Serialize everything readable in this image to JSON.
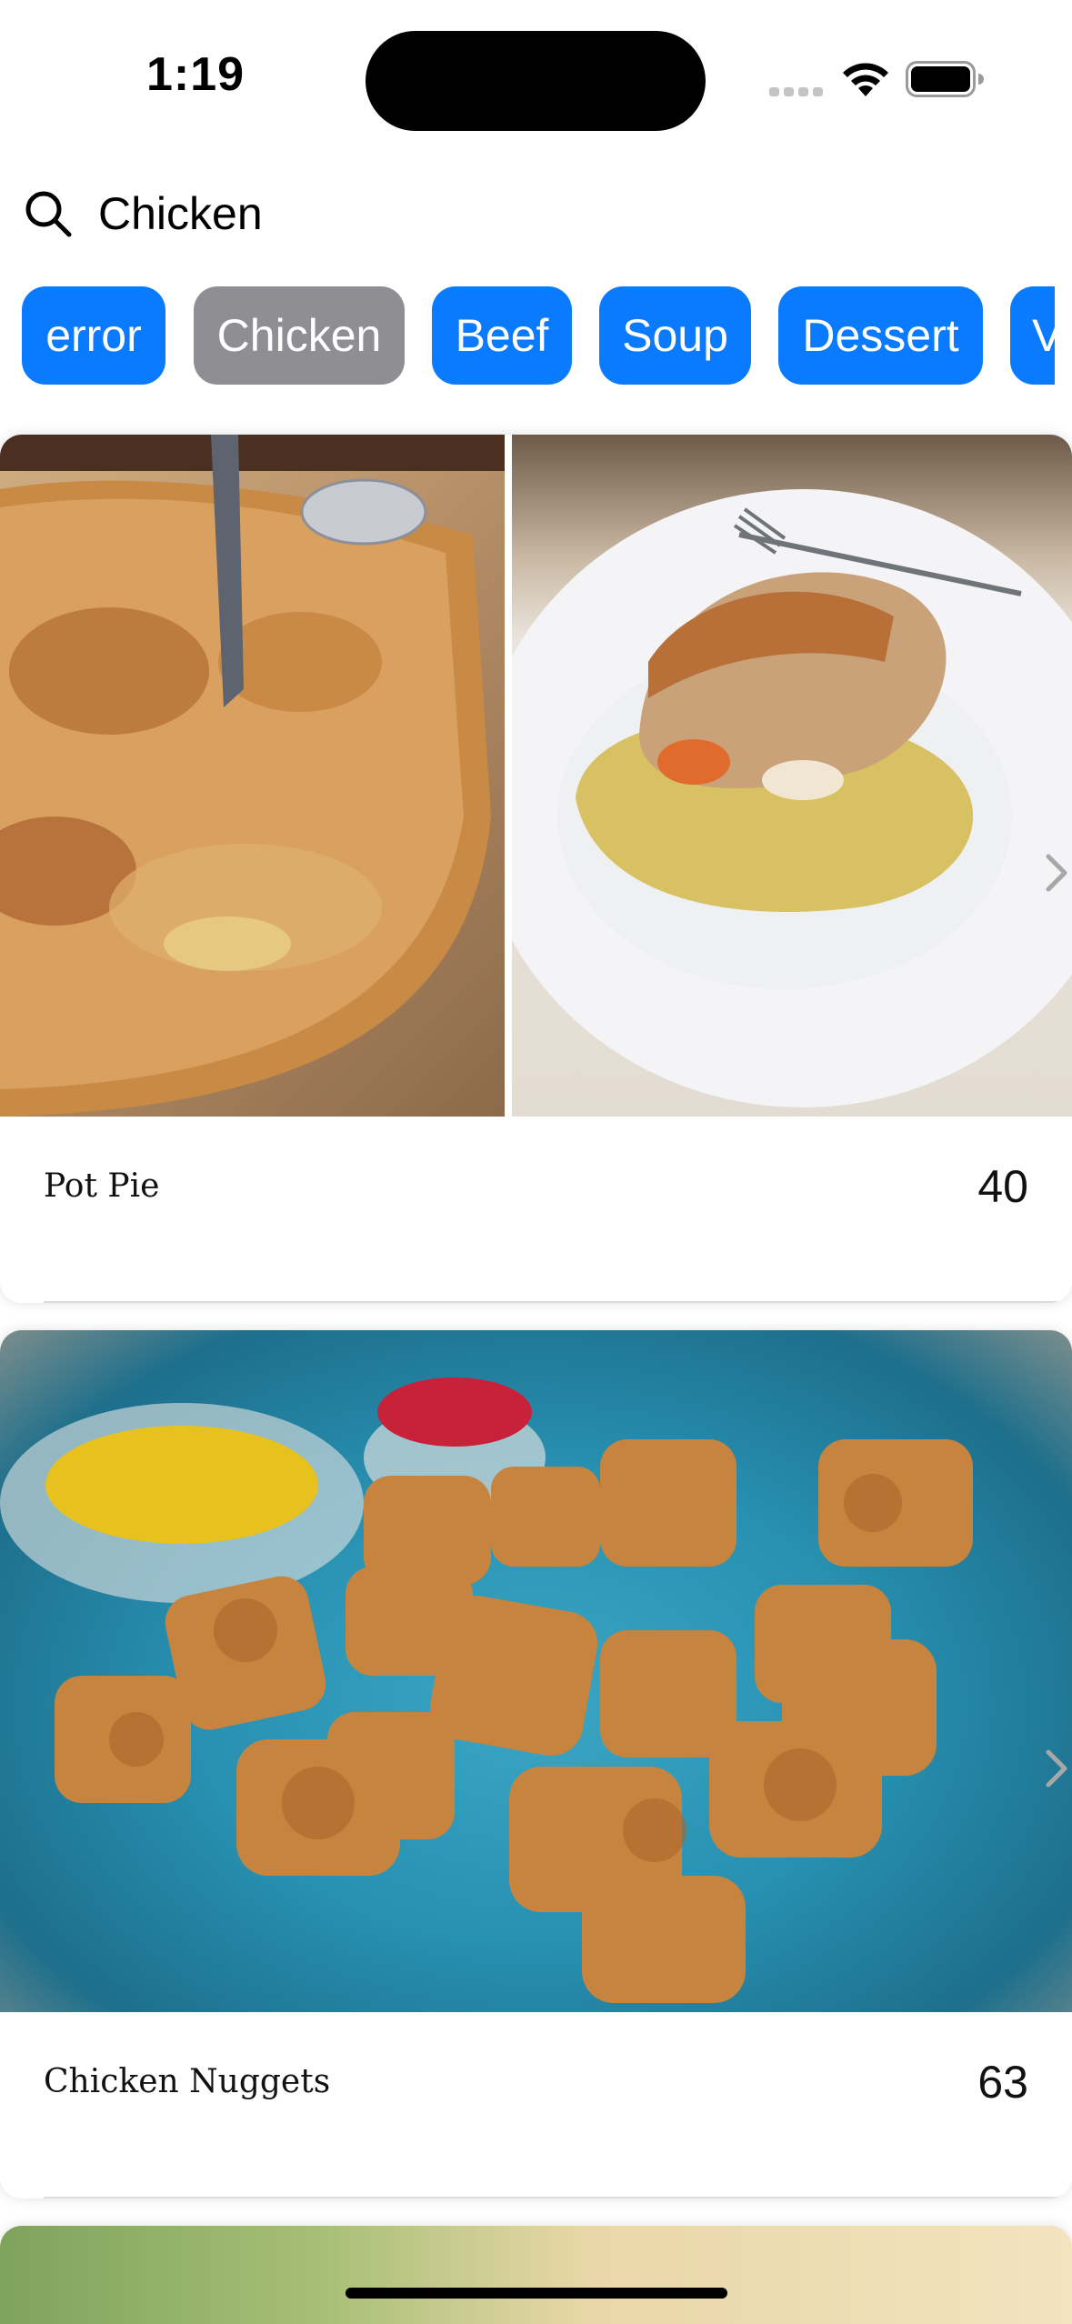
{
  "status_bar": {
    "time": "1:19",
    "icons": [
      "signal-icon",
      "wifi-icon",
      "battery-icon"
    ]
  },
  "search": {
    "value": "Chicken",
    "placeholder": "",
    "icon": "search-icon"
  },
  "categories": {
    "items": [
      "error",
      "Chicken",
      "Beef",
      "Soup",
      "Dessert",
      "V"
    ],
    "selected": "Chicken",
    "colors": {
      "default": "#0a7aff",
      "selected": "#8e8e93",
      "text": "#ffffff"
    }
  },
  "recipes": [
    {
      "name": "Pot Pie",
      "count": "40",
      "icon": "chevron-right-icon"
    },
    {
      "name": "Chicken Nuggets",
      "count": "63",
      "icon": "chevron-right-icon"
    }
  ]
}
